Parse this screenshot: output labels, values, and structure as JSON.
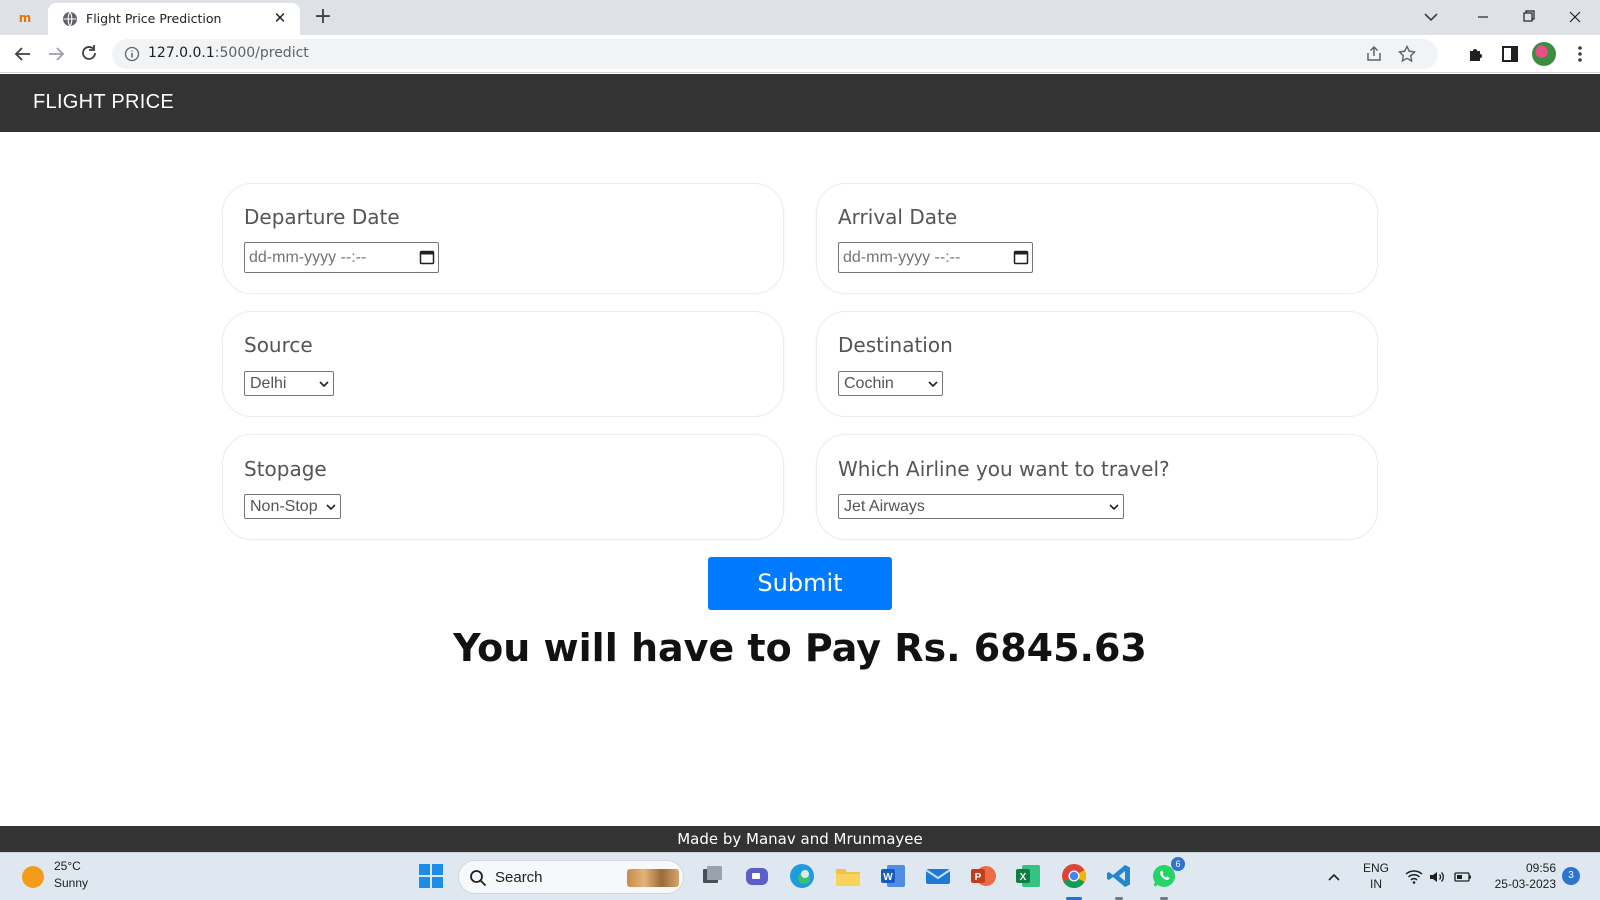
{
  "browser": {
    "tab_title": "Flight Price Prediction",
    "tab_close": "✕",
    "new_tab": "+",
    "url_host": "127.0.0.1",
    "url_path": ":5000/predict"
  },
  "navbar": {
    "brand": "FLIGHT PRICE"
  },
  "form": {
    "departure": {
      "label": "Departure Date",
      "placeholder": "dd-mm-yyyy --:--"
    },
    "arrival": {
      "label": "Arrival Date",
      "placeholder": "dd-mm-yyyy --:--"
    },
    "source": {
      "label": "Source",
      "selected": "Delhi"
    },
    "destination": {
      "label": "Destination",
      "selected": "Cochin"
    },
    "stopage": {
      "label": "Stopage",
      "selected": "Non-Stop"
    },
    "airline": {
      "label": "Which Airline you want to travel?",
      "selected": "Jet Airways"
    },
    "submit_label": "Submit"
  },
  "result": {
    "text": "You will have to Pay Rs. 6845.63"
  },
  "footer": {
    "text": "Made by Manav and Mrunmayee"
  },
  "taskbar": {
    "weather_temp": "25°C",
    "weather_desc": "Sunny",
    "search_label": "Search",
    "whatsapp_badge": "6",
    "lang_top": "ENG",
    "lang_bottom": "IN",
    "time": "09:56",
    "date": "25-03-2023",
    "notification_count": "3"
  },
  "colors": {
    "navbar_bg": "#333333",
    "submit_bg": "#007bff",
    "footer_bg": "#333333",
    "taskbar_bg": "#dfe8f0"
  },
  "icons": [
    "chevron-down-icon",
    "back-icon",
    "forward-icon",
    "reload-icon",
    "info-icon",
    "share-icon",
    "star-icon",
    "extensions-icon",
    "side-panel-icon",
    "calendar-icon",
    "windows-start-icon",
    "search-icon",
    "wifi-icon",
    "volume-icon",
    "battery-icon"
  ]
}
